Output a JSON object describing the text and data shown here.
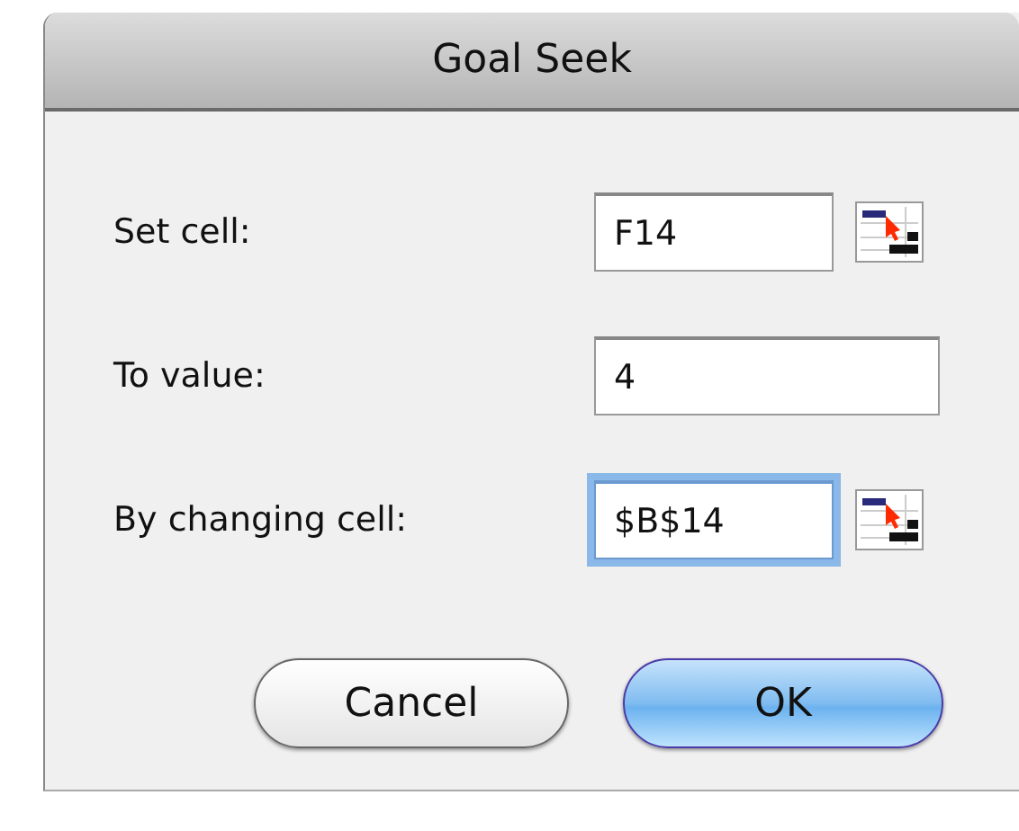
{
  "window": {
    "title": "Goal Seek"
  },
  "fields": [
    {
      "label": "Set cell:",
      "value": "F14",
      "kind": "cell-ref",
      "focused": false
    },
    {
      "label": "To value:",
      "value": "4",
      "kind": "plain",
      "focused": false
    },
    {
      "label": "By changing cell:",
      "value": "$B$14",
      "kind": "cell-ref",
      "focused": true
    }
  ],
  "buttons": [
    {
      "label": "Cancel",
      "default": false
    },
    {
      "label": "OK",
      "default": true
    }
  ]
}
